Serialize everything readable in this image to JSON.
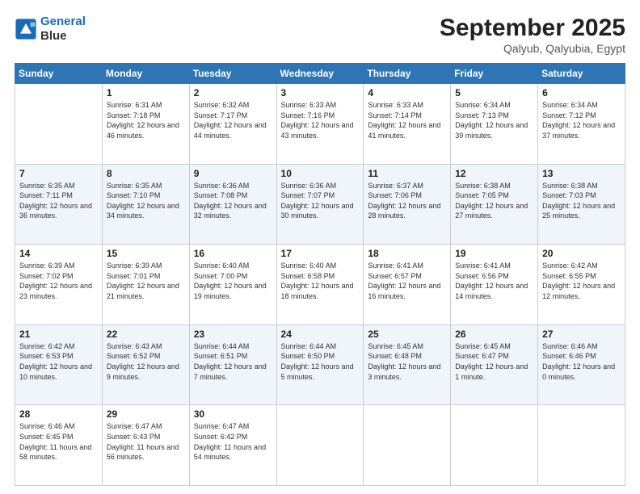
{
  "logo": {
    "line1": "General",
    "line2": "Blue"
  },
  "title": "September 2025",
  "subtitle": "Qalyub, Qalyubia, Egypt",
  "headers": [
    "Sunday",
    "Monday",
    "Tuesday",
    "Wednesday",
    "Thursday",
    "Friday",
    "Saturday"
  ],
  "weeks": [
    [
      {
        "day": "",
        "sunrise": "",
        "sunset": "",
        "daylight": ""
      },
      {
        "day": "1",
        "sunrise": "Sunrise: 6:31 AM",
        "sunset": "Sunset: 7:18 PM",
        "daylight": "Daylight: 12 hours and 46 minutes."
      },
      {
        "day": "2",
        "sunrise": "Sunrise: 6:32 AM",
        "sunset": "Sunset: 7:17 PM",
        "daylight": "Daylight: 12 hours and 44 minutes."
      },
      {
        "day": "3",
        "sunrise": "Sunrise: 6:33 AM",
        "sunset": "Sunset: 7:16 PM",
        "daylight": "Daylight: 12 hours and 43 minutes."
      },
      {
        "day": "4",
        "sunrise": "Sunrise: 6:33 AM",
        "sunset": "Sunset: 7:14 PM",
        "daylight": "Daylight: 12 hours and 41 minutes."
      },
      {
        "day": "5",
        "sunrise": "Sunrise: 6:34 AM",
        "sunset": "Sunset: 7:13 PM",
        "daylight": "Daylight: 12 hours and 39 minutes."
      },
      {
        "day": "6",
        "sunrise": "Sunrise: 6:34 AM",
        "sunset": "Sunset: 7:12 PM",
        "daylight": "Daylight: 12 hours and 37 minutes."
      }
    ],
    [
      {
        "day": "7",
        "sunrise": "Sunrise: 6:35 AM",
        "sunset": "Sunset: 7:11 PM",
        "daylight": "Daylight: 12 hours and 36 minutes."
      },
      {
        "day": "8",
        "sunrise": "Sunrise: 6:35 AM",
        "sunset": "Sunset: 7:10 PM",
        "daylight": "Daylight: 12 hours and 34 minutes."
      },
      {
        "day": "9",
        "sunrise": "Sunrise: 6:36 AM",
        "sunset": "Sunset: 7:08 PM",
        "daylight": "Daylight: 12 hours and 32 minutes."
      },
      {
        "day": "10",
        "sunrise": "Sunrise: 6:36 AM",
        "sunset": "Sunset: 7:07 PM",
        "daylight": "Daylight: 12 hours and 30 minutes."
      },
      {
        "day": "11",
        "sunrise": "Sunrise: 6:37 AM",
        "sunset": "Sunset: 7:06 PM",
        "daylight": "Daylight: 12 hours and 28 minutes."
      },
      {
        "day": "12",
        "sunrise": "Sunrise: 6:38 AM",
        "sunset": "Sunset: 7:05 PM",
        "daylight": "Daylight: 12 hours and 27 minutes."
      },
      {
        "day": "13",
        "sunrise": "Sunrise: 6:38 AM",
        "sunset": "Sunset: 7:03 PM",
        "daylight": "Daylight: 12 hours and 25 minutes."
      }
    ],
    [
      {
        "day": "14",
        "sunrise": "Sunrise: 6:39 AM",
        "sunset": "Sunset: 7:02 PM",
        "daylight": "Daylight: 12 hours and 23 minutes."
      },
      {
        "day": "15",
        "sunrise": "Sunrise: 6:39 AM",
        "sunset": "Sunset: 7:01 PM",
        "daylight": "Daylight: 12 hours and 21 minutes."
      },
      {
        "day": "16",
        "sunrise": "Sunrise: 6:40 AM",
        "sunset": "Sunset: 7:00 PM",
        "daylight": "Daylight: 12 hours and 19 minutes."
      },
      {
        "day": "17",
        "sunrise": "Sunrise: 6:40 AM",
        "sunset": "Sunset: 6:58 PM",
        "daylight": "Daylight: 12 hours and 18 minutes."
      },
      {
        "day": "18",
        "sunrise": "Sunrise: 6:41 AM",
        "sunset": "Sunset: 6:57 PM",
        "daylight": "Daylight: 12 hours and 16 minutes."
      },
      {
        "day": "19",
        "sunrise": "Sunrise: 6:41 AM",
        "sunset": "Sunset: 6:56 PM",
        "daylight": "Daylight: 12 hours and 14 minutes."
      },
      {
        "day": "20",
        "sunrise": "Sunrise: 6:42 AM",
        "sunset": "Sunset: 6:55 PM",
        "daylight": "Daylight: 12 hours and 12 minutes."
      }
    ],
    [
      {
        "day": "21",
        "sunrise": "Sunrise: 6:42 AM",
        "sunset": "Sunset: 6:53 PM",
        "daylight": "Daylight: 12 hours and 10 minutes."
      },
      {
        "day": "22",
        "sunrise": "Sunrise: 6:43 AM",
        "sunset": "Sunset: 6:52 PM",
        "daylight": "Daylight: 12 hours and 9 minutes."
      },
      {
        "day": "23",
        "sunrise": "Sunrise: 6:44 AM",
        "sunset": "Sunset: 6:51 PM",
        "daylight": "Daylight: 12 hours and 7 minutes."
      },
      {
        "day": "24",
        "sunrise": "Sunrise: 6:44 AM",
        "sunset": "Sunset: 6:50 PM",
        "daylight": "Daylight: 12 hours and 5 minutes."
      },
      {
        "day": "25",
        "sunrise": "Sunrise: 6:45 AM",
        "sunset": "Sunset: 6:48 PM",
        "daylight": "Daylight: 12 hours and 3 minutes."
      },
      {
        "day": "26",
        "sunrise": "Sunrise: 6:45 AM",
        "sunset": "Sunset: 6:47 PM",
        "daylight": "Daylight: 12 hours and 1 minute."
      },
      {
        "day": "27",
        "sunrise": "Sunrise: 6:46 AM",
        "sunset": "Sunset: 6:46 PM",
        "daylight": "Daylight: 12 hours and 0 minutes."
      }
    ],
    [
      {
        "day": "28",
        "sunrise": "Sunrise: 6:46 AM",
        "sunset": "Sunset: 6:45 PM",
        "daylight": "Daylight: 11 hours and 58 minutes."
      },
      {
        "day": "29",
        "sunrise": "Sunrise: 6:47 AM",
        "sunset": "Sunset: 6:43 PM",
        "daylight": "Daylight: 11 hours and 56 minutes."
      },
      {
        "day": "30",
        "sunrise": "Sunrise: 6:47 AM",
        "sunset": "Sunset: 6:42 PM",
        "daylight": "Daylight: 11 hours and 54 minutes."
      },
      {
        "day": "",
        "sunrise": "",
        "sunset": "",
        "daylight": ""
      },
      {
        "day": "",
        "sunrise": "",
        "sunset": "",
        "daylight": ""
      },
      {
        "day": "",
        "sunrise": "",
        "sunset": "",
        "daylight": ""
      },
      {
        "day": "",
        "sunrise": "",
        "sunset": "",
        "daylight": ""
      }
    ]
  ]
}
